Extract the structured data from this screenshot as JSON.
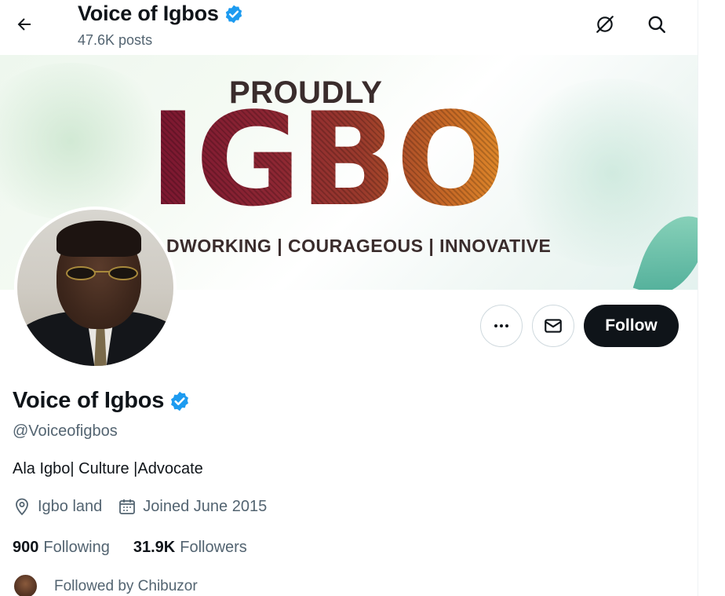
{
  "header": {
    "back_label": "Back",
    "title": "Voice of Igbos",
    "posts": "47.6K posts"
  },
  "banner": {
    "line1": "PROUDLY",
    "line2": "IGBO",
    "tagline": "DWORKING | COURAGEOUS | INNOVATIVE"
  },
  "actions": {
    "follow_label": "Follow"
  },
  "profile": {
    "name": "Voice of Igbos",
    "handle": "@Voiceofigbos",
    "bio": "Ala Igbo| Culture |Advocate",
    "location": "Igbo land",
    "joined": "Joined June 2015",
    "following_count": "900",
    "following_label": "Following",
    "followers_count": "31.9K",
    "followers_label": "Followers",
    "followed_by": "Followed by Chibuzor"
  },
  "colors": {
    "verified": "#1d9bf0",
    "text_primary": "#0f1419",
    "text_secondary": "#536471",
    "follow_bg": "#0f1419"
  },
  "icons": {
    "back": "arrow-left-icon",
    "grok": "grok-icon",
    "search": "search-icon",
    "more": "more-icon",
    "mail": "mail-icon",
    "verified": "verified-badge-icon",
    "location": "location-pin-icon",
    "calendar": "calendar-icon"
  }
}
